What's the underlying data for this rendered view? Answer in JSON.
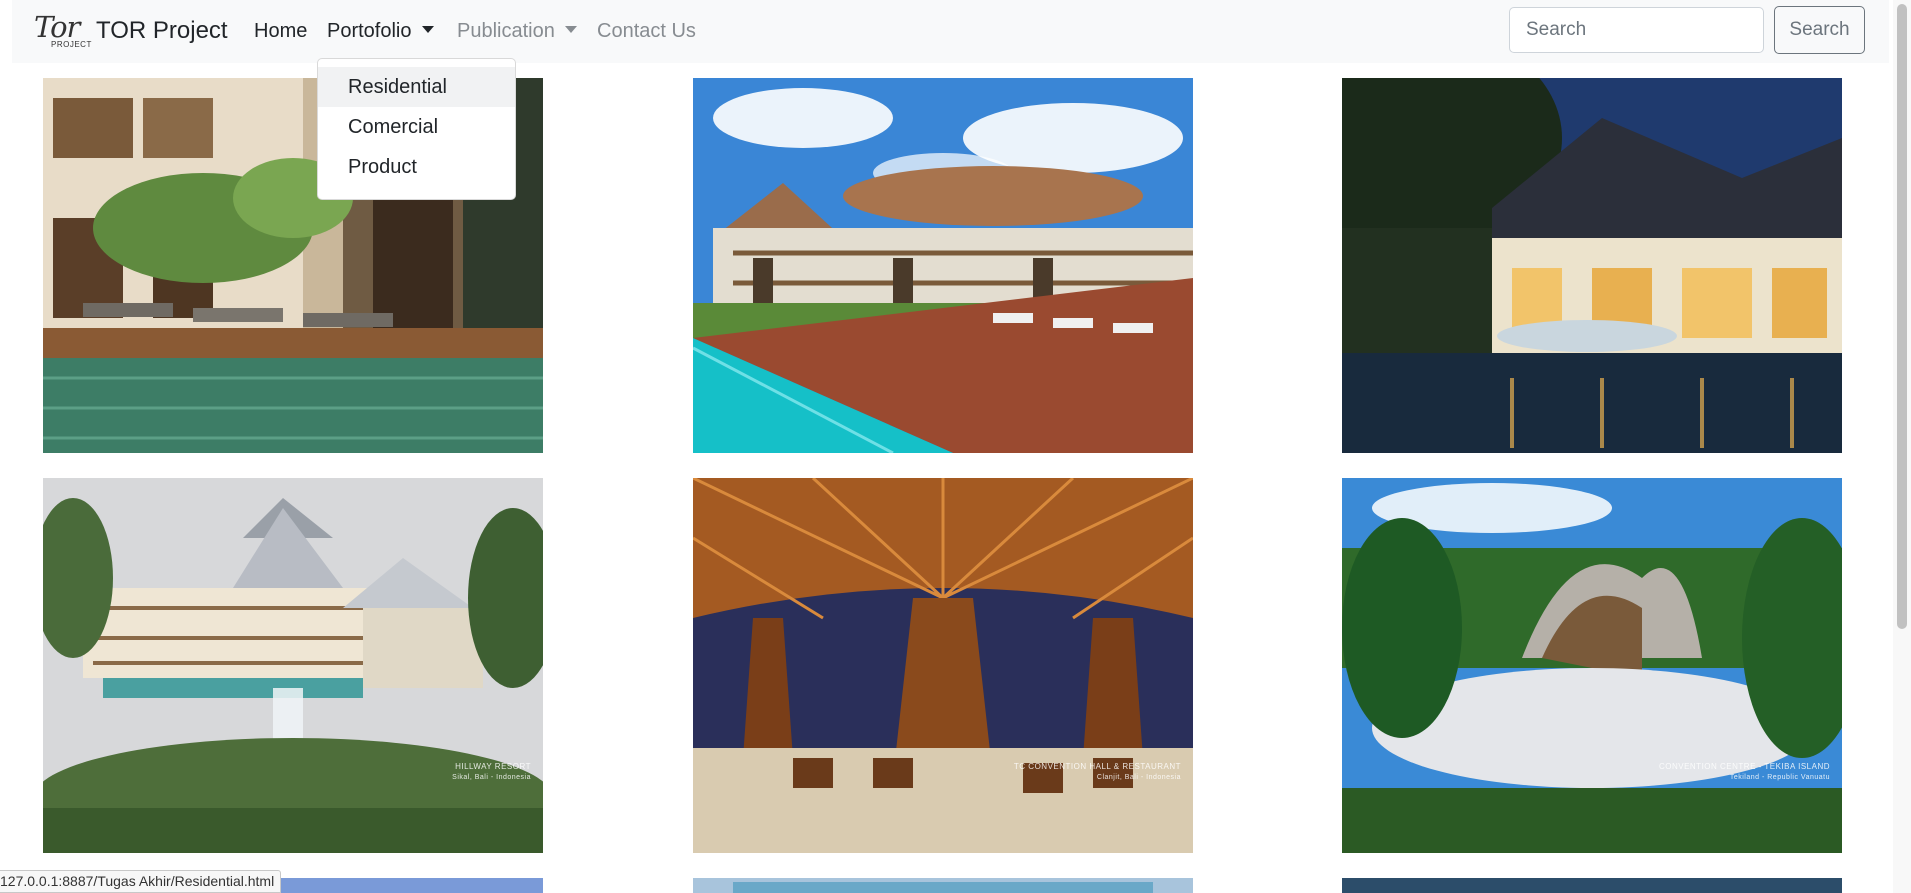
{
  "navbar": {
    "logo_script": "Tor",
    "logo_sub": "PROJECT",
    "brand": "TOR Project",
    "items": [
      {
        "label": "Home"
      },
      {
        "label": "Portofolio"
      },
      {
        "label": "Publication"
      },
      {
        "label": "Contact Us"
      }
    ],
    "search_placeholder": "Search",
    "search_button": "Search"
  },
  "dropdown": {
    "items": [
      {
        "label": "Residential",
        "state": "hovered"
      },
      {
        "label": "Comercial"
      },
      {
        "label": "Product"
      }
    ]
  },
  "gallery": {
    "captions": {
      "photo_4": {
        "title": "HILLWAY RESORT",
        "sub": "Sikal, Bali - Indonesia"
      },
      "photo_5": {
        "title": "TC CONVENTION HALL & RESTAURANT",
        "sub": "Clanjit, Bali - Indonesia"
      },
      "photo_6": {
        "title": "CONVENTION CENTRE - TEKIBA ISLAND",
        "sub": "Tekiland - Republic Vanuatu"
      }
    }
  },
  "status_bar": {
    "url": "127.0.0.1:8887/Tugas Akhir/Residential.html"
  },
  "colors": {
    "navbar_bg": "#f8f9fa",
    "muted_link": "#878c91",
    "button_outline": "#6c757d"
  }
}
